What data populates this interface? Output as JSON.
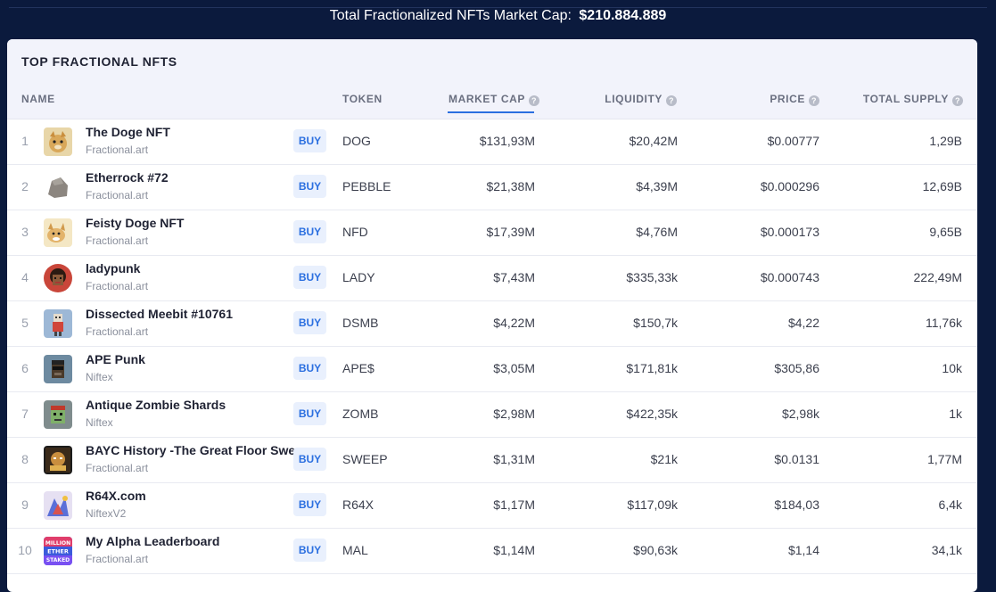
{
  "header": {
    "label": "Total Fractionalized NFTs Market Cap:",
    "value": "$210.884.889"
  },
  "card": {
    "title": "TOP FRACTIONAL NFTS"
  },
  "columns": {
    "name": "NAME",
    "token": "TOKEN",
    "market_cap": "MARKET CAP",
    "liquidity": "LIQUIDITY",
    "price": "PRICE",
    "total_supply": "TOTAL SUPPLY",
    "help_glyph": "?"
  },
  "buy_label": "BUY",
  "rows": [
    {
      "rank": "1",
      "name": "The Doge NFT",
      "source": "Fractional.art",
      "token": "DOG",
      "market_cap": "$131,93M",
      "liquidity": "$20,42M",
      "price": "$0.00777",
      "total_supply": "1,29B"
    },
    {
      "rank": "2",
      "name": "Etherrock #72",
      "source": "Fractional.art",
      "token": "PEBBLE",
      "market_cap": "$21,38M",
      "liquidity": "$4,39M",
      "price": "$0.000296",
      "total_supply": "12,69B"
    },
    {
      "rank": "3",
      "name": "Feisty Doge NFT",
      "source": "Fractional.art",
      "token": "NFD",
      "market_cap": "$17,39M",
      "liquidity": "$4,76M",
      "price": "$0.000173",
      "total_supply": "9,65B"
    },
    {
      "rank": "4",
      "name": "ladypunk",
      "source": "Fractional.art",
      "token": "LADY",
      "market_cap": "$7,43M",
      "liquidity": "$335,33k",
      "price": "$0.000743",
      "total_supply": "222,49M"
    },
    {
      "rank": "5",
      "name": "Dissected Meebit #10761",
      "source": "Fractional.art",
      "token": "DSMB",
      "market_cap": "$4,22M",
      "liquidity": "$150,7k",
      "price": "$4,22",
      "total_supply": "11,76k"
    },
    {
      "rank": "6",
      "name": "APE Punk",
      "source": "Niftex",
      "token": "APE$",
      "market_cap": "$3,05M",
      "liquidity": "$171,81k",
      "price": "$305,86",
      "total_supply": "10k"
    },
    {
      "rank": "7",
      "name": "Antique Zombie Shards",
      "source": "Niftex",
      "token": "ZOMB",
      "market_cap": "$2,98M",
      "liquidity": "$422,35k",
      "price": "$2,98k",
      "total_supply": "1k"
    },
    {
      "rank": "8",
      "name": "BAYC History -The Great Floor Sweep",
      "source": "Fractional.art",
      "token": "SWEEP",
      "market_cap": "$1,31M",
      "liquidity": "$21k",
      "price": "$0.0131",
      "total_supply": "1,77M"
    },
    {
      "rank": "9",
      "name": "R64X.com",
      "source": "NiftexV2",
      "token": "R64X",
      "market_cap": "$1,17M",
      "liquidity": "$117,09k",
      "price": "$184,03",
      "total_supply": "6,4k"
    },
    {
      "rank": "10",
      "name": "My Alpha Leaderboard",
      "source": "Fractional.art",
      "token": "MAL",
      "market_cap": "$1,14M",
      "liquidity": "$90,63k",
      "price": "$1,14",
      "total_supply": "34,1k",
      "thumb_text": [
        "MILLION",
        "ETHER",
        "STAKED"
      ]
    }
  ],
  "colors": {
    "page_bg": "#0b1a3d",
    "accent": "#2b6fe0",
    "buy_bg": "#e9f0fd"
  }
}
